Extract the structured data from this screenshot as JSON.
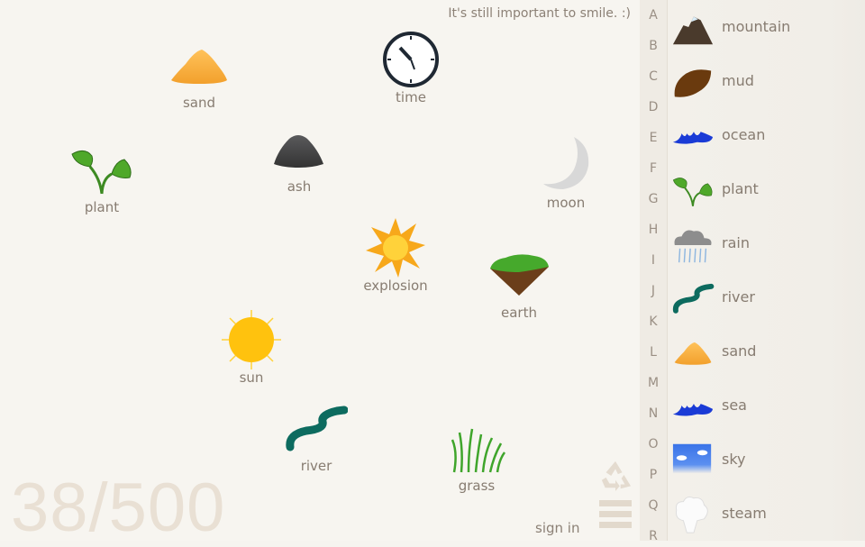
{
  "tip": "It's still important to smile. :)",
  "counter": "38/500",
  "sign_in": "sign in",
  "workspace": [
    {
      "label": "sand",
      "icon": "sand-icon"
    },
    {
      "label": "time",
      "icon": "clock-icon"
    },
    {
      "label": "ash",
      "icon": "ash-icon"
    },
    {
      "label": "plant",
      "icon": "plant-icon"
    },
    {
      "label": "moon",
      "icon": "moon-icon"
    },
    {
      "label": "explosion",
      "icon": "explosion-icon"
    },
    {
      "label": "earth",
      "icon": "earth-icon"
    },
    {
      "label": "sun",
      "icon": "sun-icon"
    },
    {
      "label": "river",
      "icon": "river-icon"
    },
    {
      "label": "grass",
      "icon": "grass-icon"
    }
  ],
  "letters": [
    "A",
    "B",
    "C",
    "D",
    "E",
    "F",
    "G",
    "H",
    "I",
    "J",
    "K",
    "L",
    "M",
    "N",
    "O",
    "P",
    "Q",
    "R"
  ],
  "sidebar": [
    {
      "label": "mountain",
      "icon": "mountain-icon"
    },
    {
      "label": "mud",
      "icon": "mud-icon"
    },
    {
      "label": "ocean",
      "icon": "ocean-icon"
    },
    {
      "label": "plant",
      "icon": "plant-icon"
    },
    {
      "label": "rain",
      "icon": "rain-icon"
    },
    {
      "label": "river",
      "icon": "river-icon"
    },
    {
      "label": "sand",
      "icon": "sand-icon"
    },
    {
      "label": "sea",
      "icon": "sea-icon"
    },
    {
      "label": "sky",
      "icon": "sky-icon"
    },
    {
      "label": "steam",
      "icon": "steam-icon"
    }
  ]
}
